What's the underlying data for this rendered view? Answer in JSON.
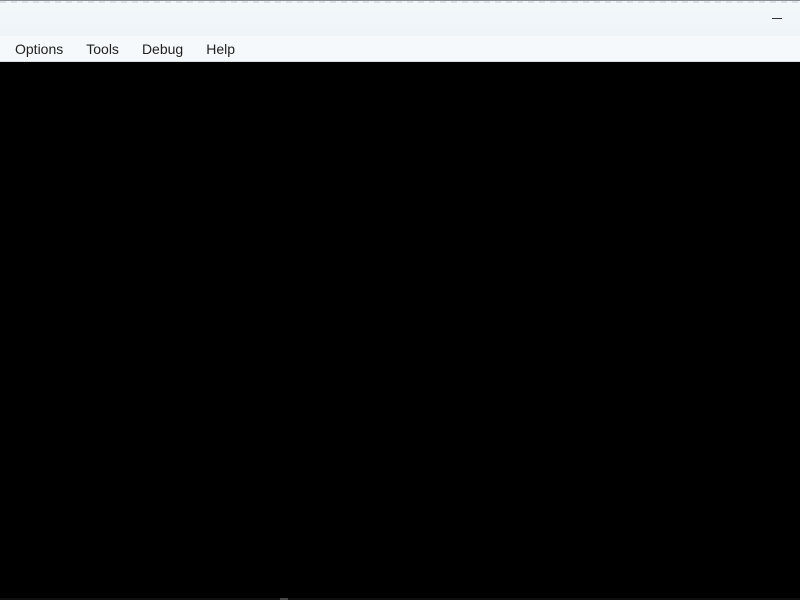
{
  "window": {
    "minimize_symbol": "—"
  },
  "menu": {
    "items": [
      {
        "label": "Options"
      },
      {
        "label": "Tools"
      },
      {
        "label": "Debug"
      },
      {
        "label": "Help"
      }
    ]
  },
  "icons": {
    "minimize": "minimize-icon"
  },
  "colors": {
    "titlebar_bg": "#f3f8fb",
    "menu_bg": "#f6f9fb",
    "content_bg": "#000000",
    "menu_text": "#1f1f1f"
  }
}
